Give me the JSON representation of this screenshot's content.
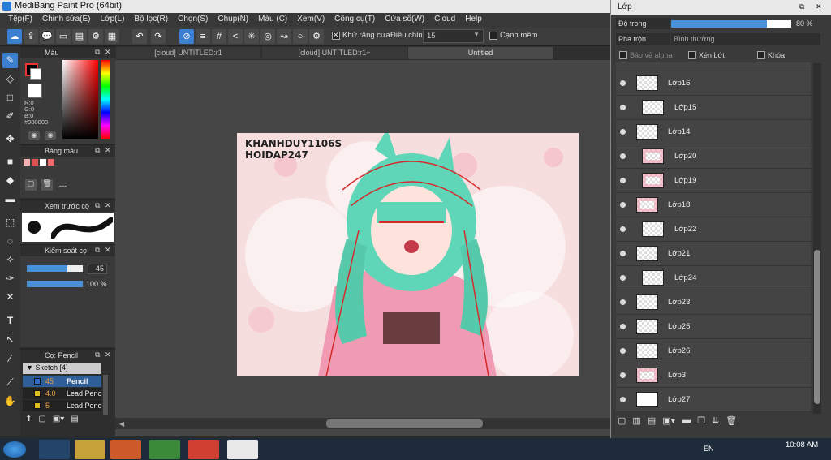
{
  "window": {
    "title": "MediBang Paint Pro (64bit)"
  },
  "menu": [
    "Tệp(F)",
    "Chỉnh sửa(E)",
    "Lớp(L)",
    "Bộ lọc(R)",
    "Chọn(S)",
    "Chụp(N)",
    "Màu (C)",
    "Xem(V)",
    "Công cụ(T)",
    "Cửa sổ(W)",
    "Cloud",
    "Help"
  ],
  "toolbar": {
    "antialias_label": "Khử răng cưa",
    "correction_label": "Điều chỉnh",
    "correction_value": "15",
    "snap_label": "Cạnh mềm"
  },
  "tabs": [
    "[cloud] UNTITLED:r1",
    "[cloud] UNTITLED:r1+",
    "Untitled"
  ],
  "color_panel": {
    "title": "Màu",
    "r": "R:0",
    "g": "G:0",
    "b": "B:0",
    "hex": "#000000"
  },
  "palette_panel": {
    "title": "Bảng màu",
    "dash": "---"
  },
  "brush_preview": {
    "title": "Xem trước cọ"
  },
  "brush_control": {
    "title": "Kiểm soát cọ",
    "size": "45",
    "opacity": "100 %"
  },
  "brush_list": {
    "title": "Cọ: Pencil",
    "group": "Sketch [4]",
    "items": [
      {
        "size": "45",
        "name": "Pencil",
        "color": "#2d6fc7"
      },
      {
        "size": "4.0",
        "name": "Lead Penc",
        "color": "#e0c020"
      },
      {
        "size": "5",
        "name": "Lead Penc",
        "color": "#e0c020"
      }
    ]
  },
  "artwork": {
    "line1": "KHANHDUY1106S",
    "line2": "HOIDAP247"
  },
  "layer_window": {
    "title": "Lớp",
    "opacity_label": "Độ trong",
    "opacity_value": "80 %",
    "opacity_fraction": 0.8,
    "blend_label": "Pha trộn",
    "blend_value": "Bình thường",
    "protect_alpha": "Bảo vệ alpha",
    "clipping": "Xén bớt",
    "lock": "Khóa",
    "layers": [
      {
        "name": "Lớp16",
        "clip": false,
        "thumb": "checker"
      },
      {
        "name": "Lớp15",
        "clip": true,
        "thumb": "checker"
      },
      {
        "name": "Lớp14",
        "clip": false,
        "thumb": "checker"
      },
      {
        "name": "Lớp20",
        "clip": true,
        "thumb": "pink"
      },
      {
        "name": "Lớp19",
        "clip": true,
        "thumb": "pink"
      },
      {
        "name": "Lớp18",
        "clip": false,
        "thumb": "pink"
      },
      {
        "name": "Lớp22",
        "clip": true,
        "thumb": "checker"
      },
      {
        "name": "Lớp21",
        "clip": false,
        "thumb": "checker"
      },
      {
        "name": "Lớp24",
        "clip": true,
        "thumb": "checker"
      },
      {
        "name": "Lớp23",
        "clip": false,
        "thumb": "checker"
      },
      {
        "name": "Lớp25",
        "clip": false,
        "thumb": "checker"
      },
      {
        "name": "Lớp26",
        "clip": false,
        "thumb": "checker"
      },
      {
        "name": "Lớp3",
        "clip": false,
        "thumb": "pink"
      },
      {
        "name": "Lớp27",
        "clip": false,
        "thumb": "white"
      }
    ]
  },
  "taskbar": {
    "lang": "EN",
    "time": "10:08 AM"
  },
  "colors": {
    "accent": "#3a7fd0",
    "canvas_bg": "#f7dede",
    "hair": "#5fd6b8",
    "kimono": "#f19ab4"
  }
}
